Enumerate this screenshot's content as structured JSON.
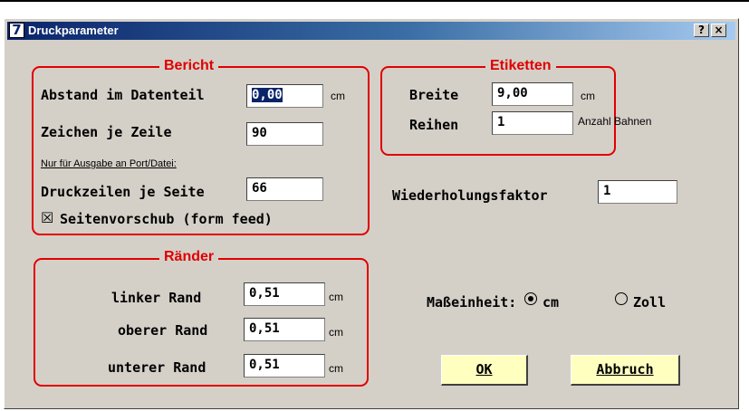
{
  "window": {
    "title": "Druckparameter",
    "app_icon_text": "7",
    "help_button": "?",
    "close_button": "×"
  },
  "bericht": {
    "legend": "Bericht",
    "abstand_label": "Abstand im Datenteil",
    "abstand_value": "0,00",
    "abstand_unit": "cm",
    "zeichen_label": "Zeichen je Zeile",
    "zeichen_value": "90",
    "port_note": "Nur für Ausgabe an Port/Datei:",
    "druckzeilen_label": "Druckzeilen je Seite",
    "druckzeilen_value": "66",
    "formfeed_label": "Seitenvorschub (form feed)",
    "formfeed_checked": true,
    "formfeed_mark": "☒"
  },
  "etiketten": {
    "legend": "Etiketten",
    "breite_label": "Breite",
    "breite_value": "9,00",
    "breite_unit": "cm",
    "reihen_label": "Reihen",
    "reihen_value": "1",
    "reihen_unit": "Anzahl Bahnen"
  },
  "wiederholung": {
    "label": "Wiederholungsfaktor",
    "value": "1"
  },
  "raender": {
    "legend": "Ränder",
    "linker_label": "linker Rand",
    "linker_value": "0,51",
    "oberer_label": "oberer Rand",
    "oberer_value": "0,51",
    "unterer_label": "unterer Rand",
    "unterer_value": "0,51",
    "unit": "cm"
  },
  "masseinheit": {
    "label": "Maßeinheit:",
    "options": [
      "cm",
      "Zoll"
    ],
    "selected": "cm"
  },
  "buttons": {
    "ok": "OK",
    "abbruch": "Abbruch"
  },
  "colors": {
    "title_gradient_start": "#0a246a",
    "title_gradient_end": "#a6caf0",
    "group_border": "#e00000",
    "dialog_face": "#d4d0c8",
    "button_face": "#ffffc0"
  }
}
